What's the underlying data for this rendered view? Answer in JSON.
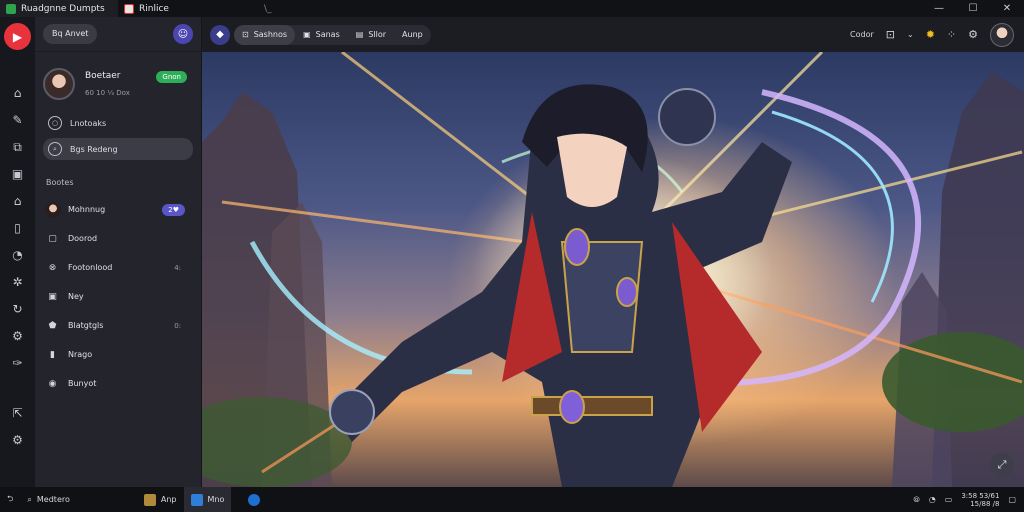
{
  "window": {
    "tabs": [
      {
        "label": "Ruadgnne Dumpts",
        "color": "#2ea44f"
      },
      {
        "label": "Rinlice",
        "color": "#d33"
      },
      {
        "label": "\\_",
        "color": ""
      }
    ],
    "controls": {
      "minimize": "—",
      "maximize": "☐",
      "close": "✕"
    }
  },
  "rail": {
    "logo_glyph": "▶",
    "icons": [
      "home-icon",
      "pencil-icon",
      "inbox-icon",
      "square-icon",
      "bag-icon",
      "book-icon",
      "clock-icon",
      "settings-icon",
      "refresh-icon",
      "gear-icon",
      "wrench-icon",
      "export-icon",
      "cog-icon"
    ]
  },
  "sidebar": {
    "top_pill": "Bq Anvet",
    "profile": {
      "name": "Boetaer",
      "meta": "60  10  ⅓  Dox",
      "badge": "Gnon"
    },
    "nav": [
      {
        "label": "Lnotoaks",
        "active": false
      },
      {
        "label": "Bgs Redeng",
        "active": true
      }
    ],
    "section_title": "Bootes",
    "items": [
      {
        "label": "Mohnnug",
        "trail": "2♥",
        "purple": true,
        "avatar": true
      },
      {
        "label": "Doorod",
        "trail": ""
      },
      {
        "label": "Footonlood",
        "trail": "4:"
      },
      {
        "label": "Ney",
        "trail": ""
      },
      {
        "label": "Blatgtgls",
        "trail": "0:"
      },
      {
        "label": "Nrago",
        "trail": ""
      },
      {
        "label": "Bunyot",
        "trail": ""
      }
    ]
  },
  "toolbar": {
    "chips": [
      "Sashnos",
      "Sanas",
      "Sllor",
      "Aunp"
    ],
    "right_label": "Codor",
    "zoom_label": "⌄"
  },
  "taskbar": {
    "left": [
      "Medtero"
    ],
    "apps": [
      {
        "label": "Anp",
        "color": "#b08a3a"
      },
      {
        "label": "Mno",
        "color": "#2f7fd8"
      }
    ],
    "clock": [
      "3:58 53/61",
      "15/88 /8"
    ]
  }
}
